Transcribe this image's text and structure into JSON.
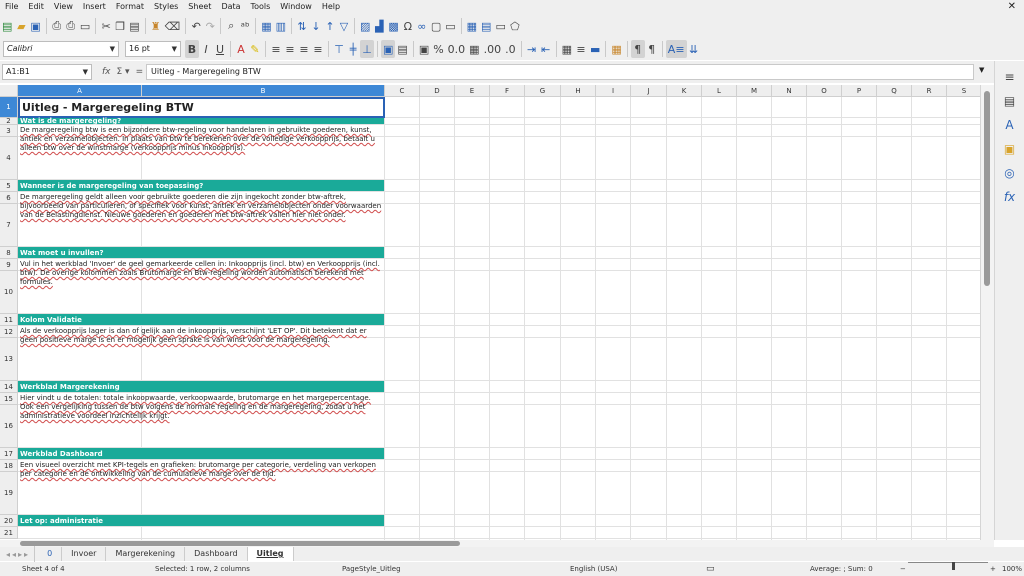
{
  "menubar": {
    "items": [
      "File",
      "Edit",
      "View",
      "Insert",
      "Format",
      "Styles",
      "Sheet",
      "Data",
      "Tools",
      "Window",
      "Help"
    ],
    "close_glyph": "✕"
  },
  "toolbar2": {
    "font_name": "Calibri",
    "font_size": "16 pt"
  },
  "formula": {
    "cell_ref": "A1:B1",
    "content": "Uitleg - Margeregeling BTW"
  },
  "columns": [
    "A",
    "B",
    "C",
    "D",
    "E",
    "F",
    "G",
    "H",
    "I",
    "J",
    "K",
    "L",
    "M",
    "N",
    "O",
    "P",
    "Q",
    "R",
    "S"
  ],
  "rows": [
    "1",
    "2",
    "3",
    "4",
    "5",
    "6",
    "7",
    "8",
    "9",
    "10",
    "11",
    "12",
    "13",
    "14",
    "15",
    "16",
    "17",
    "18",
    "19",
    "20",
    "21"
  ],
  "sheet": {
    "title": "Uitleg - Margeregeling BTW",
    "sections": [
      {
        "heading": "Wat is de margeregeling?",
        "text": "De margeregeling btw is een bijzondere btw-regeling voor handelaren in gebruikte goederen, kunst, antiek en verzamelobjecten. In plaats van btw te berekenen over de volledige verkoopprijs, betaalt u alleen btw over de winstmarge (verkoopprijs minus inkoopprijs)."
      },
      {
        "heading": "Wanneer is de margeregeling van toepassing?",
        "text": "De margeregeling geldt alleen voor gebruikte goederen die zijn ingekocht zonder btw-aftrek, bijvoorbeeld van particulieren, of specifiek voor kunst, antiek en verzamelobjecten onder voorwaarden van de Belastingdienst. Nieuwe goederen en goederen met btw-aftrek vallen hier niet onder."
      },
      {
        "heading": "Wat moet u invullen?",
        "text": "Vul in het werkblad 'Invoer' de geel gemarkeerde cellen in: Inkoopprijs (incl. btw) en Verkoopprijs (incl. btw). De overige kolommen zoals Brutomarge en Btw-regeling worden automatisch berekend met formules."
      },
      {
        "heading": "Kolom Validatie",
        "text": "Als de verkoopprijs lager is dan of gelijk aan de inkoopprijs, verschijnt 'LET OP'. Dit betekent dat er geen positieve marge is en er mogelijk geen sprake is van winst voor de margeregeling."
      },
      {
        "heading": "Werkblad Margerekening",
        "text": "Hier vindt u de totalen: totale inkoopwaarde, verkoopwaarde, brutomarge en het margepercentage. Ook een vergelijking tussen de btw volgens de normale regeling en de margeregeling, zodat u het administratieve voordeel inzichtelijk krijgt."
      },
      {
        "heading": "Werkblad Dashboard",
        "text": "Een visueel overzicht met KPI-tegels en grafieken: brutomarge per categorie, verdeling van verkopen per categorie en de ontwikkeling van de cumulatieve marge over de tijd."
      },
      {
        "heading": "Let op: administratie",
        "text": ""
      }
    ]
  },
  "tabs": {
    "counter": "0",
    "items": [
      "Invoer",
      "Margerekening",
      "Dashboard",
      "Uitleg"
    ],
    "active": "Uitleg"
  },
  "status": {
    "sheet": "Sheet 4 of 4",
    "selection": "Selected: 1 row, 2 columns",
    "page_style": "PageStyle_Uitleg",
    "language": "English (USA)",
    "summary": "Average: ; Sum: 0",
    "zoom": "100%"
  },
  "colors": {
    "accent": "#1aaa99",
    "selection": "#3d88d6"
  }
}
